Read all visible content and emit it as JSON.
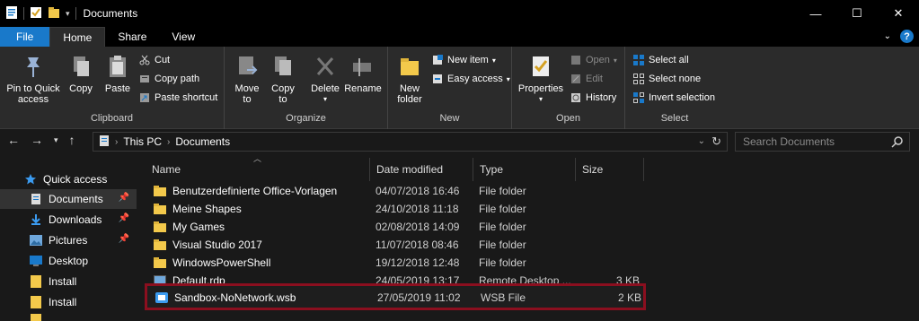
{
  "window": {
    "title": "Documents",
    "controls": [
      "—",
      "☐",
      "✕"
    ]
  },
  "tabs": {
    "items": [
      "File",
      "Home",
      "Share",
      "View"
    ]
  },
  "ribbon": {
    "clipboard": {
      "label": "Clipboard",
      "pin_to_quick_access": [
        "Pin to Quick",
        "access"
      ],
      "copy": "Copy",
      "paste": "Paste",
      "cut": "Cut",
      "copy_path": "Copy path",
      "paste_shortcut": "Paste shortcut"
    },
    "organize": {
      "label": "Organize",
      "move_to": [
        "Move",
        "to"
      ],
      "copy_to": [
        "Copy",
        "to"
      ],
      "delete": "Delete",
      "rename": "Rename"
    },
    "new": {
      "label": "New",
      "new_folder": [
        "New",
        "folder"
      ],
      "new_item": "New item",
      "easy_access": "Easy access"
    },
    "open": {
      "label": "Open",
      "properties": "Properties",
      "open": "Open",
      "edit": "Edit",
      "history": "History"
    },
    "select": {
      "label": "Select",
      "select_all": "Select all",
      "select_none": "Select none",
      "invert_selection": "Invert selection"
    }
  },
  "address": {
    "crumbs": [
      "This PC",
      "Documents"
    ],
    "search_placeholder": "Search Documents"
  },
  "navpane": {
    "quick_access": "Quick access",
    "items": [
      {
        "label": "Documents",
        "pinned": true,
        "icon": "documents-icon"
      },
      {
        "label": "Downloads",
        "pinned": true,
        "icon": "downloads-icon"
      },
      {
        "label": "Pictures",
        "pinned": true,
        "icon": "pictures-icon"
      },
      {
        "label": "Desktop",
        "pinned": false,
        "icon": "desktop-icon"
      },
      {
        "label": "Install",
        "pinned": false,
        "icon": "folder-icon"
      },
      {
        "label": "Install",
        "pinned": false,
        "icon": "folder-icon"
      }
    ]
  },
  "columns": {
    "name": "Name",
    "date": "Date modified",
    "type": "Type",
    "size": "Size"
  },
  "files": [
    {
      "name": "Benutzerdefinierte Office-Vorlagen",
      "date": "04/07/2018 16:46",
      "type": "File folder",
      "size": ""
    },
    {
      "name": "Meine Shapes",
      "date": "24/10/2018 11:18",
      "type": "File folder",
      "size": ""
    },
    {
      "name": "My Games",
      "date": "02/08/2018 14:09",
      "type": "File folder",
      "size": ""
    },
    {
      "name": "Visual Studio 2017",
      "date": "11/07/2018 08:46",
      "type": "File folder",
      "size": ""
    },
    {
      "name": "WindowsPowerShell",
      "date": "19/12/2018 12:48",
      "type": "File folder",
      "size": ""
    },
    {
      "name": "Default.rdp",
      "date": "24/05/2019 13:17",
      "type": "Remote Desktop ...",
      "size": "3 KB"
    },
    {
      "name": "Sandbox-NoNetwork.wsb",
      "date": "27/05/2019 11:02",
      "type": "WSB File",
      "size": "2 KB"
    }
  ],
  "colors": {
    "accent": "#1979ca",
    "folder": "#f3c94b",
    "highlight_border": "#8b0f1f"
  }
}
